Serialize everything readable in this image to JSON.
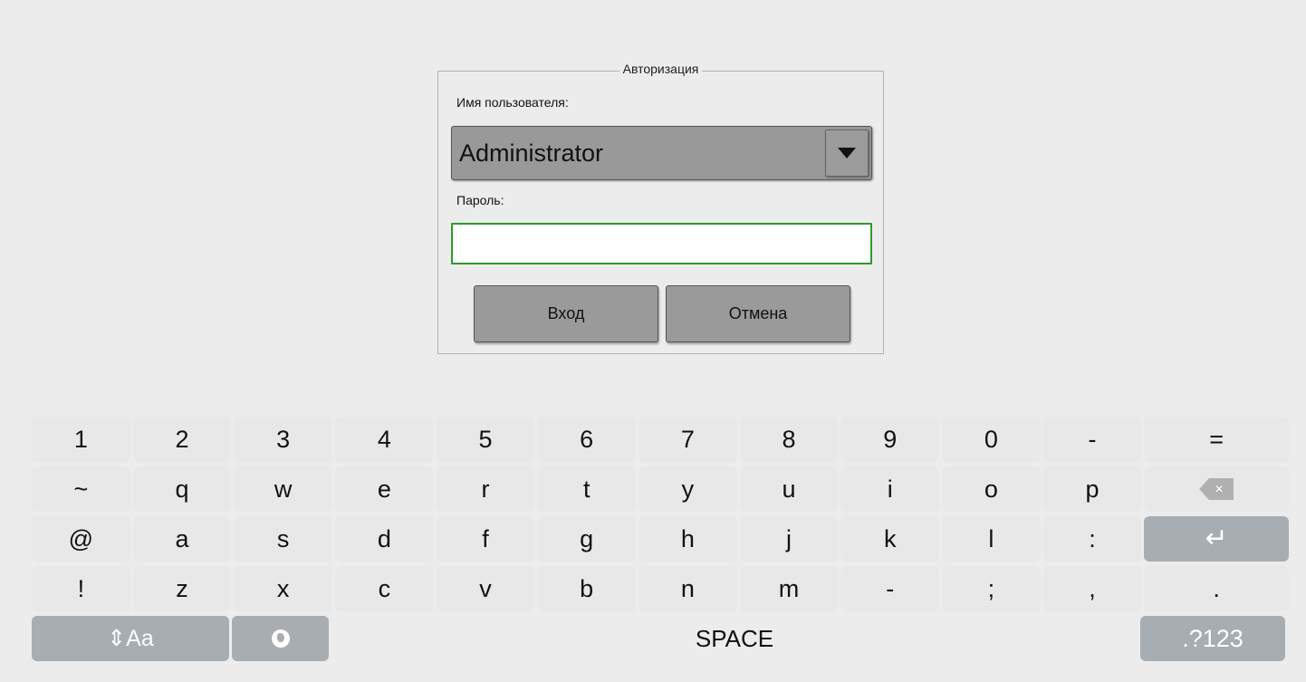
{
  "dialog": {
    "title": "Авторизация",
    "user_label": "Имя пользователя:",
    "user_value": "Administrator",
    "password_label": "Пароль:",
    "password_value": "",
    "login_button": "Вход",
    "cancel_button": "Отмена"
  },
  "keyboard": {
    "row1": [
      "1",
      "2",
      "3",
      "4",
      "5",
      "6",
      "7",
      "8",
      "9",
      "0",
      "-",
      "="
    ],
    "row2": [
      "~",
      "q",
      "w",
      "e",
      "r",
      "t",
      "y",
      "u",
      "i",
      "o",
      "p"
    ],
    "row3": [
      "@",
      "a",
      "s",
      "d",
      "f",
      "g",
      "h",
      "j",
      "k",
      "l",
      ":"
    ],
    "row4": [
      "!",
      "z",
      "x",
      "c",
      "v",
      "b",
      "n",
      "m",
      "-",
      ";",
      ",",
      "."
    ],
    "shift_label": "⇕Aa",
    "space_label": "SPACE",
    "symbols_label": ".?123",
    "backspace_icon": "backspace-icon",
    "enter_icon": "enter-icon",
    "globe_icon": "globe-icon"
  },
  "colors": {
    "background": "#ececec",
    "focus_border": "#2d9a2d",
    "special_key": "#a8adb1"
  }
}
